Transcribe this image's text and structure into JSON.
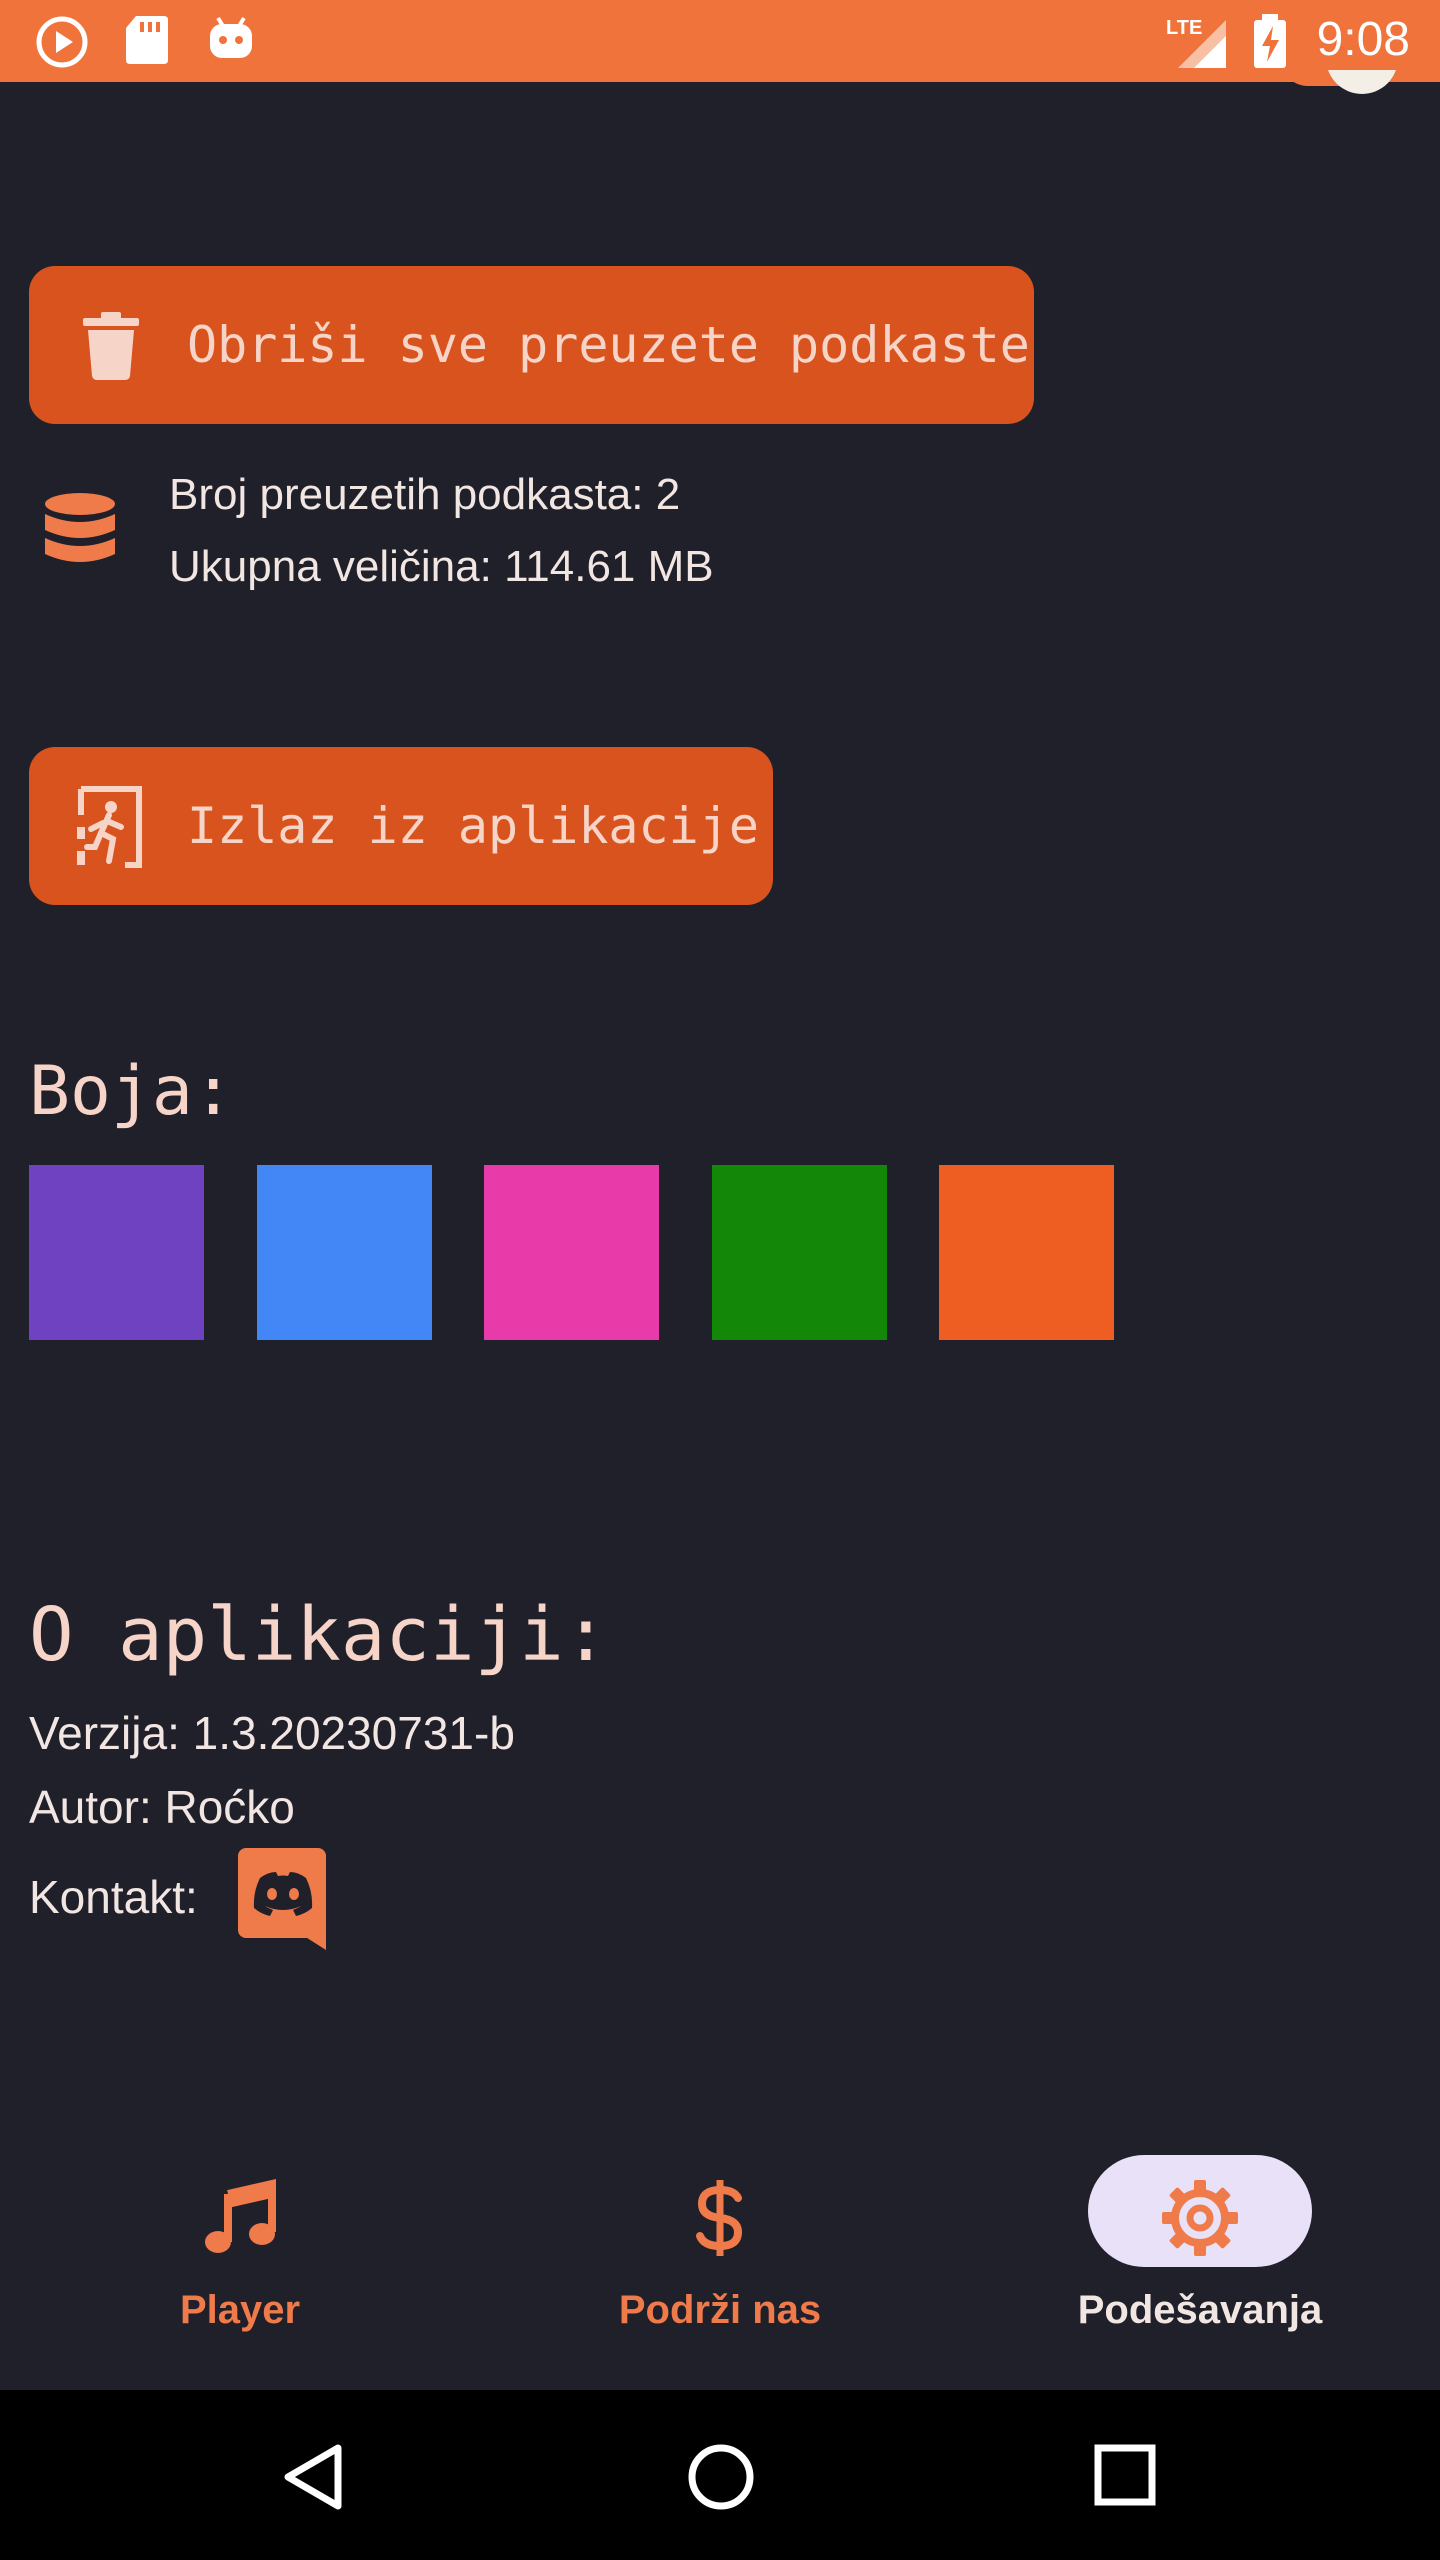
{
  "status_bar": {
    "time": "9:08",
    "network": "LTE",
    "icons": [
      "play-circle-icon",
      "sd-card-icon",
      "android-icon",
      "signal-icon",
      "battery-charging-icon"
    ]
  },
  "buttons": {
    "delete_downloads": "Obriši sve preuzete podkaste",
    "exit_app": "Izlaz iz aplikacije"
  },
  "storage": {
    "downloaded_count": "Broj preuzetih podkasta: 2",
    "total_size": "Ukupna veličina: 114.61 MB"
  },
  "color_section": {
    "title": "Boja:",
    "swatches": [
      "#6f42c1",
      "#4287f5",
      "#e83aa9",
      "#138808",
      "#ee5e22"
    ]
  },
  "about": {
    "title": "O aplikaciji:",
    "version": "Verzija: 1.3.20230731-b",
    "author": "Autor: Roćko",
    "contact": "Kontakt:"
  },
  "bottom_nav": {
    "items": [
      {
        "label": "Player",
        "icon": "music-note-icon",
        "active": false
      },
      {
        "label": "Podrži nas",
        "icon": "dollar-icon",
        "active": false
      },
      {
        "label": "Podešavanja",
        "icon": "gear-icon",
        "active": true
      }
    ]
  },
  "colors": {
    "accent": "#f0733c",
    "button_bg": "#d9531e",
    "background": "#20202b",
    "active_pill": "#e9e1f7"
  }
}
